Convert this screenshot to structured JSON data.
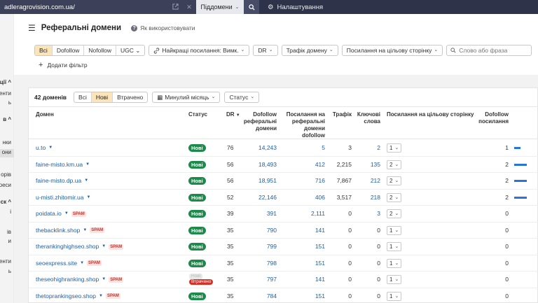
{
  "topbar": {
    "url": "adleragrovision.com.ua/",
    "subdomains_label": "Піддомени",
    "settings_label": "Налаштування"
  },
  "sidebar": {
    "items": [
      {
        "label": "ції ^",
        "bold": true
      },
      {
        "label": "енти",
        "bold": false
      },
      {
        "label": "ь",
        "bold": false
      },
      {
        "label": "в ^",
        "bold": true
      },
      {
        "label": "нки",
        "bold": false
      },
      {
        "label": "они",
        "bold": false
      },
      {
        "label": "орів",
        "bold": false
      },
      {
        "label": "реси",
        "bold": false
      },
      {
        "label": "ск ^",
        "bold": true
      },
      {
        "label": "і",
        "bold": false
      },
      {
        "label": "ів",
        "bold": false
      },
      {
        "label": "и",
        "bold": false
      },
      {
        "label": "енти",
        "bold": false
      },
      {
        "label": "ь",
        "bold": false
      }
    ]
  },
  "header": {
    "title": "Реферальні домени",
    "howto": "Як використовувати"
  },
  "filters": {
    "type_segments": [
      "Всі",
      "Dofollow",
      "Nofollow",
      "UGC"
    ],
    "best_links": "Найкращі посилання: Вимк.",
    "dr": "DR",
    "traffic": "Трафік домену",
    "target_link": "Посилання на цільову сторінку",
    "search_placeholder": "Слово або фраза",
    "add_filter": "Додати фільтр"
  },
  "table_toolbar": {
    "count": "42 доменів",
    "segments": [
      "Всі",
      "Нові",
      "Втрачено"
    ],
    "period": "Минулий місяць",
    "status": "Статус"
  },
  "columns": {
    "domain": "Домен",
    "status": "Статус",
    "dr": "DR",
    "dofollow_ref": [
      "Dofollow",
      "реферальні",
      "домени"
    ],
    "links_ref": [
      "Посилання на",
      "реферальні",
      "домени",
      "dofollow"
    ],
    "traffic": "Трафік",
    "keywords": [
      "Ключові",
      "слова"
    ],
    "target": "Посилання на цільову сторінку",
    "dofollow_links": [
      "Dofollow",
      "посилання"
    ]
  },
  "rows": [
    {
      "domain": "u.to",
      "spam": false,
      "status": "Нові",
      "lost": false,
      "dr": "76",
      "dofollow_ref": "14,243",
      "links": "5",
      "traffic": "3",
      "keywords": "2",
      "target": "1",
      "dofollow": "1",
      "bar": 0.25
    },
    {
      "domain": "faine-misto.km.ua",
      "spam": false,
      "status": "Нові",
      "lost": false,
      "dr": "56",
      "dofollow_ref": "18,493",
      "links": "412",
      "traffic": "2,215",
      "keywords": "135",
      "target": "2",
      "dofollow": "2",
      "bar": 0.5
    },
    {
      "domain": "faine-misto.dp.ua",
      "spam": false,
      "status": "Нові",
      "lost": false,
      "dr": "56",
      "dofollow_ref": "18,951",
      "links": "716",
      "traffic": "7,867",
      "keywords": "212",
      "target": "2",
      "dofollow": "2",
      "bar": 0.5
    },
    {
      "domain": "u-misti.zhitomir.ua",
      "spam": false,
      "status": "Нові",
      "lost": false,
      "dr": "52",
      "dofollow_ref": "22,146",
      "links": "406",
      "traffic": "3,517",
      "keywords": "218",
      "target": "2",
      "dofollow": "2",
      "bar": 0.5
    },
    {
      "domain": "poidata.io",
      "spam": true,
      "status": "Нові",
      "lost": false,
      "dr": "39",
      "dofollow_ref": "391",
      "links": "2,111",
      "traffic": "0",
      "keywords": "3",
      "target": "2",
      "dofollow": "0",
      "bar": 0
    },
    {
      "domain": "thebacklink.shop",
      "spam": true,
      "status": "Нові",
      "lost": false,
      "dr": "35",
      "dofollow_ref": "790",
      "links": "141",
      "traffic": "0",
      "keywords": "0",
      "target": "1",
      "dofollow": "0",
      "bar": 0
    },
    {
      "domain": "therankinghighseo.shop",
      "spam": true,
      "status": "Нові",
      "lost": false,
      "dr": "35",
      "dofollow_ref": "799",
      "links": "151",
      "traffic": "0",
      "keywords": "0",
      "target": "1",
      "dofollow": "0",
      "bar": 0
    },
    {
      "domain": "seoexpress.site",
      "spam": true,
      "status": "Нові",
      "lost": false,
      "dr": "35",
      "dofollow_ref": "798",
      "links": "151",
      "traffic": "0",
      "keywords": "0",
      "target": "1",
      "dofollow": "0",
      "bar": 0
    },
    {
      "domain": "theseohighranking.shop",
      "spam": true,
      "status": "Нові",
      "lost": true,
      "lost_label": "Втрачено",
      "dr": "35",
      "dofollow_ref": "797",
      "links": "141",
      "traffic": "0",
      "keywords": "0",
      "target": "1",
      "dofollow": "0",
      "bar": 0
    },
    {
      "domain": "thetoprankingseo.shop",
      "spam": true,
      "status": "Нові",
      "lost": false,
      "dr": "35",
      "dofollow_ref": "784",
      "links": "151",
      "traffic": "0",
      "keywords": "0",
      "target": "1",
      "dofollow": "0",
      "bar": 0
    }
  ],
  "spam_label": "SPAM",
  "colors": {
    "accent": "#fbe4b8",
    "status_new": "#1d8a4b",
    "status_lost": "#d93025",
    "link": "#1e5fa8",
    "topbar": "#2f3349"
  }
}
